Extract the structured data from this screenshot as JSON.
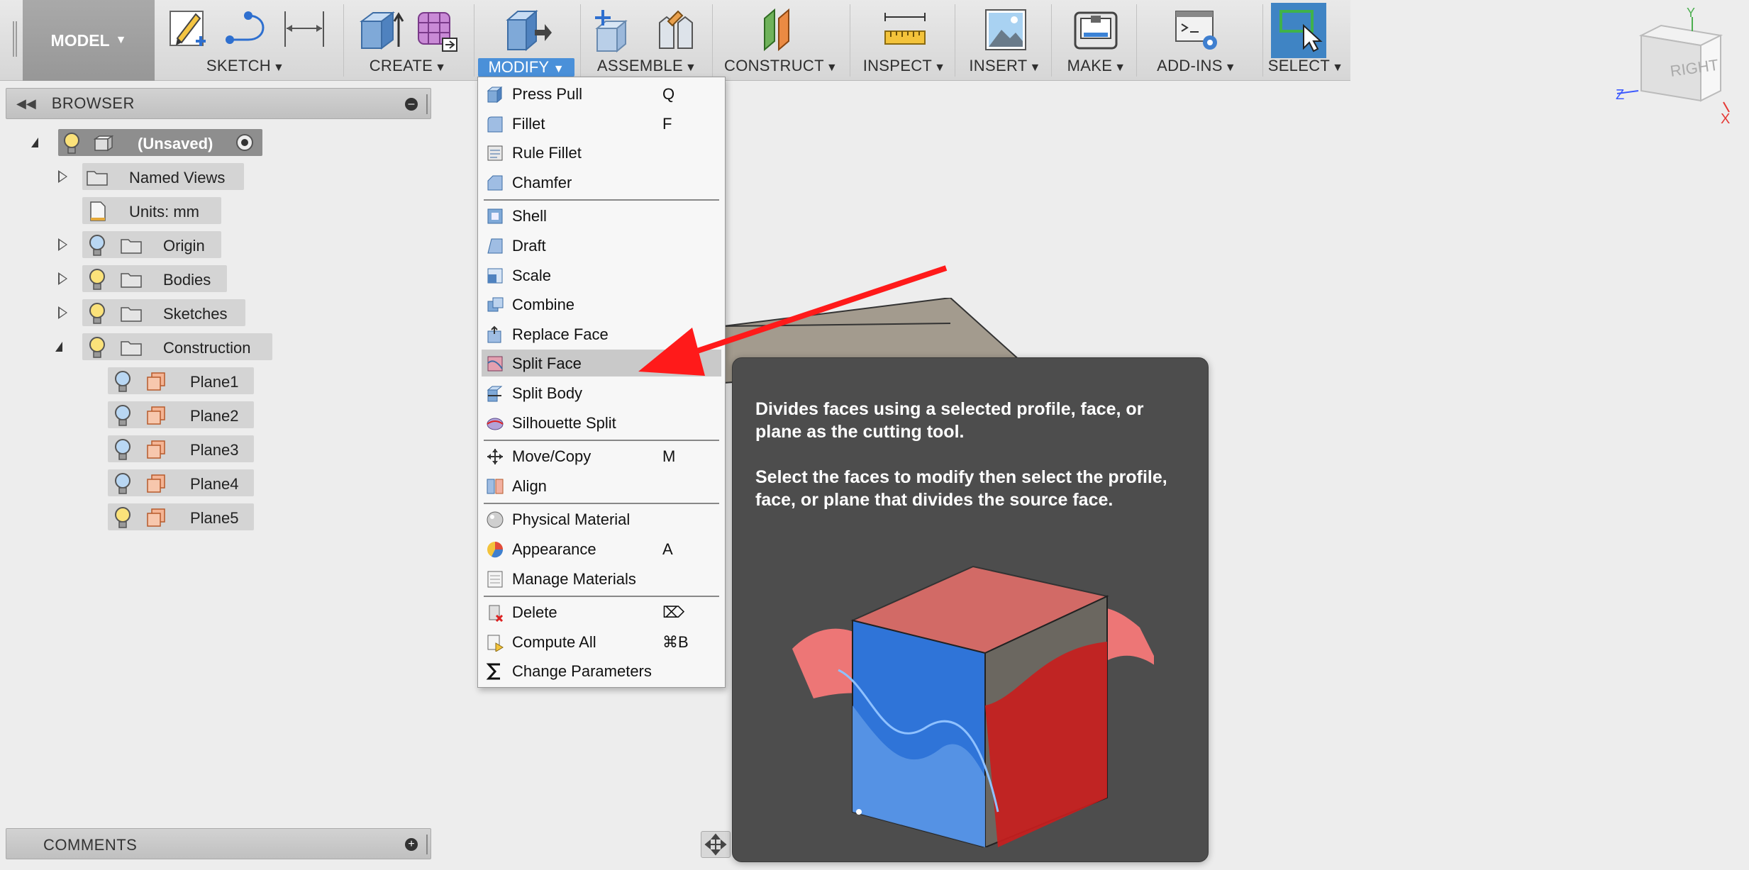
{
  "toolbar": {
    "workspace": "MODEL",
    "groups": {
      "sketch": "SKETCH",
      "create": "CREATE",
      "modify": "MODIFY",
      "assemble": "ASSEMBLE",
      "construct": "CONSTRUCT",
      "inspect": "INSPECT",
      "insert": "INSERT",
      "make": "MAKE",
      "addins": "ADD-INS",
      "select": "SELECT"
    }
  },
  "browser": {
    "title": "BROWSER",
    "root": "(Unsaved)",
    "named_views": "Named Views",
    "units": "Units: mm",
    "origin": "Origin",
    "bodies": "Bodies",
    "sketches": "Sketches",
    "construction": "Construction",
    "planes": [
      "Plane1",
      "Plane2",
      "Plane3",
      "Plane4",
      "Plane5"
    ]
  },
  "comments": {
    "title": "COMMENTS"
  },
  "modify_menu": {
    "items": [
      {
        "label": "Press Pull",
        "key": "Q",
        "icon": "press-pull-icon"
      },
      {
        "label": "Fillet",
        "key": "F",
        "icon": "fillet-icon"
      },
      {
        "label": "Rule Fillet",
        "key": "",
        "icon": "rule-fillet-icon"
      },
      {
        "label": "Chamfer",
        "key": "",
        "icon": "chamfer-icon"
      },
      {
        "label": "Shell",
        "key": "",
        "icon": "shell-icon"
      },
      {
        "label": "Draft",
        "key": "",
        "icon": "draft-icon"
      },
      {
        "label": "Scale",
        "key": "",
        "icon": "scale-icon"
      },
      {
        "label": "Combine",
        "key": "",
        "icon": "combine-icon"
      },
      {
        "label": "Replace Face",
        "key": "",
        "icon": "replace-face-icon"
      },
      {
        "label": "Split Face",
        "key": "",
        "icon": "split-face-icon"
      },
      {
        "label": "Split Body",
        "key": "",
        "icon": "split-body-icon"
      },
      {
        "label": "Silhouette Split",
        "key": "",
        "icon": "silhouette-split-icon"
      },
      {
        "label": "Move/Copy",
        "key": "M",
        "icon": "move-copy-icon"
      },
      {
        "label": "Align",
        "key": "",
        "icon": "align-icon"
      },
      {
        "label": "Physical Material",
        "key": "",
        "icon": "physical-material-icon"
      },
      {
        "label": "Appearance",
        "key": "A",
        "icon": "appearance-icon"
      },
      {
        "label": "Manage Materials",
        "key": "",
        "icon": "manage-materials-icon"
      },
      {
        "label": "Delete",
        "key": "⌦",
        "icon": "delete-icon"
      },
      {
        "label": "Compute All",
        "key": "⌘B",
        "icon": "compute-all-icon"
      },
      {
        "label": "Change Parameters",
        "key": "",
        "icon": "sigma-icon"
      }
    ]
  },
  "tooltip": {
    "p1": "Divides faces using a selected profile, face, or plane as the cutting tool.",
    "p2": "Select the faces to modify then select the profile, face, or plane that divides the source face."
  },
  "viewcube": {
    "face": "RIGHT",
    "x": "X",
    "y": "Y",
    "z": "Z"
  },
  "colors": {
    "accent": "#4a90d9",
    "arrow": "#ff1a1a",
    "tooltip_bg": "#4d4d4d"
  }
}
